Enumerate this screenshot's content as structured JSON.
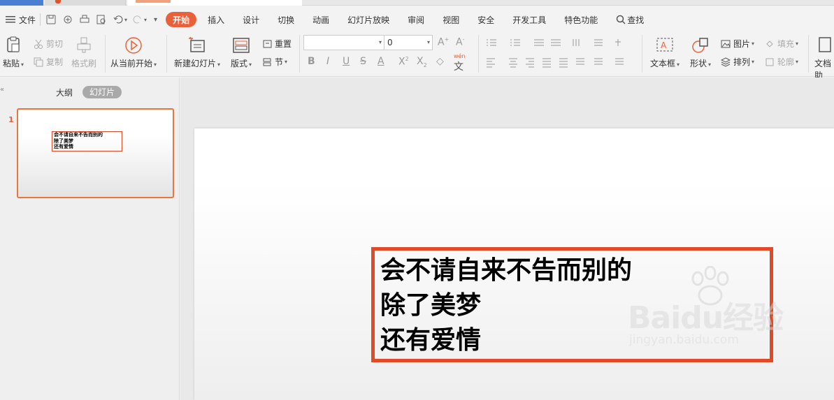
{
  "menubar": {
    "file_label": "文件",
    "tabs": [
      "开始",
      "插入",
      "设计",
      "切换",
      "动画",
      "幻灯片放映",
      "审阅",
      "视图",
      "安全",
      "开发工具",
      "特色功能"
    ],
    "search_label": "查找"
  },
  "ribbon": {
    "paste": "粘贴",
    "cut": "剪切",
    "copy": "复制",
    "format_painter": "格式刷",
    "from_current": "从当前开始",
    "new_slide": "新建幻灯片",
    "layout": "版式",
    "reset": "重置",
    "section": "节",
    "font_size": "0",
    "text_box": "文本框",
    "shape": "形状",
    "picture": "图片",
    "arrange": "排列",
    "fill": "填充",
    "outline": "轮廓",
    "doc_assist": "文档助"
  },
  "panel": {
    "outline_tab": "大纲",
    "slides_tab": "幻灯片",
    "slide_number": "1",
    "thumb_lines": [
      "会不请自来不告而别的",
      "除了美梦",
      "还有爱情"
    ]
  },
  "slide": {
    "lines": [
      "会不请自来不告而别的",
      "除了美梦",
      "还有爱情"
    ]
  },
  "watermark": {
    "brand": "Baidu经验",
    "url": "jingyan.baidu.com"
  },
  "colors": {
    "accent": "#e9613b",
    "textbox_border": "#e14a26"
  }
}
